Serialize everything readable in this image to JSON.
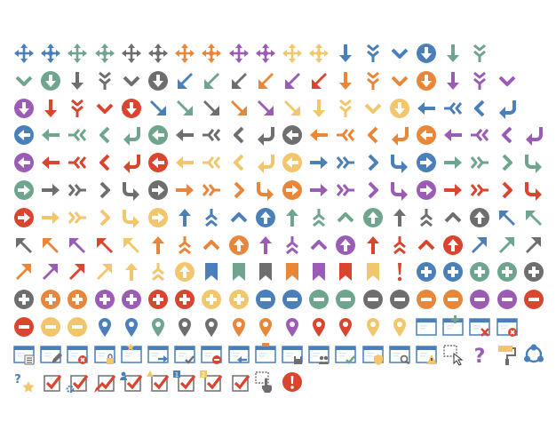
{
  "palette": {
    "blue": "#4A7FBA",
    "green": "#6FA58E",
    "orange": "#E8873A",
    "purple": "#9B5CB5",
    "yellow": "#F2C66D",
    "gray": "#6E6E6E",
    "red": "#D9452E"
  },
  "rows": [
    [
      [
        "move",
        "blue"
      ],
      [
        "move-dot",
        "blue"
      ],
      [
        "move",
        "green"
      ],
      [
        "move-dot",
        "green"
      ],
      [
        "move",
        "gray"
      ],
      [
        "move-dot",
        "gray"
      ],
      [
        "move",
        "orange"
      ],
      [
        "move-dot",
        "orange"
      ],
      [
        "move",
        "purple"
      ],
      [
        "move-dot",
        "purple"
      ],
      [
        "move",
        "yellow"
      ],
      [
        "move-dot",
        "yellow"
      ],
      [
        "down-arrow",
        "blue"
      ],
      [
        "down-chevrons",
        "blue"
      ],
      [
        "down-chevron",
        "blue"
      ],
      [
        "down-circle",
        "blue"
      ],
      [
        "down-arrow",
        "green"
      ],
      [
        "down-chevrons",
        "green"
      ]
    ],
    [
      [
        "down-chevron",
        "green"
      ],
      [
        "down-circle",
        "green"
      ],
      [
        "down-arrow",
        "gray"
      ],
      [
        "down-chevrons",
        "gray"
      ],
      [
        "down-chevron",
        "gray"
      ],
      [
        "down-circle",
        "gray"
      ],
      [
        "downleft-arrow",
        "blue"
      ],
      [
        "downleft-arrow",
        "green"
      ],
      [
        "downleft-arrow",
        "gray"
      ],
      [
        "downleft-arrow",
        "orange"
      ],
      [
        "downleft-arrow",
        "purple"
      ],
      [
        "downleft-arrow",
        "red"
      ],
      [
        "down-arrow",
        "orange"
      ],
      [
        "down-chevrons",
        "orange"
      ],
      [
        "down-chevron",
        "orange"
      ],
      [
        "down-circle",
        "orange"
      ],
      [
        "down-arrow",
        "purple"
      ],
      [
        "down-chevrons",
        "purple"
      ],
      [
        "down-chevron",
        "purple"
      ]
    ],
    [
      [
        "down-circle",
        "purple"
      ],
      [
        "down-arrow",
        "red"
      ],
      [
        "down-chevrons",
        "red"
      ],
      [
        "down-chevron",
        "red"
      ],
      [
        "down-circle",
        "red"
      ],
      [
        "downright-arrow",
        "blue"
      ],
      [
        "downright-arrow",
        "green"
      ],
      [
        "downright-arrow",
        "gray"
      ],
      [
        "downright-arrow",
        "orange"
      ],
      [
        "downright-arrow",
        "purple"
      ],
      [
        "downright-arrow",
        "yellow"
      ],
      [
        "down-arrow",
        "yellow"
      ],
      [
        "down-chevrons",
        "yellow"
      ],
      [
        "down-chevron",
        "yellow"
      ],
      [
        "down-circle",
        "yellow"
      ],
      [
        "left-arrow",
        "blue"
      ],
      [
        "left-chevrons",
        "blue"
      ],
      [
        "left-chevron",
        "blue"
      ],
      [
        "left-turn",
        "blue"
      ]
    ],
    [
      [
        "left-circle",
        "blue"
      ],
      [
        "left-arrow",
        "green"
      ],
      [
        "left-chevrons",
        "green"
      ],
      [
        "left-chevron",
        "green"
      ],
      [
        "left-turn",
        "green"
      ],
      [
        "left-circle",
        "green"
      ],
      [
        "left-arrow",
        "gray"
      ],
      [
        "left-chevrons",
        "gray"
      ],
      [
        "left-chevron",
        "gray"
      ],
      [
        "left-turn",
        "gray"
      ],
      [
        "left-circle",
        "gray"
      ],
      [
        "left-arrow",
        "orange"
      ],
      [
        "left-chevrons",
        "orange"
      ],
      [
        "left-chevron",
        "orange"
      ],
      [
        "left-turn",
        "orange"
      ],
      [
        "left-circle",
        "orange"
      ],
      [
        "left-arrow",
        "purple"
      ],
      [
        "left-chevrons",
        "purple"
      ],
      [
        "left-chevron",
        "purple"
      ],
      [
        "left-turn",
        "purple"
      ]
    ],
    [
      [
        "left-circle",
        "purple"
      ],
      [
        "left-arrow",
        "red"
      ],
      [
        "left-chevrons",
        "red"
      ],
      [
        "left-chevron",
        "red"
      ],
      [
        "left-turn",
        "red"
      ],
      [
        "left-circle",
        "red"
      ],
      [
        "left-arrow",
        "yellow"
      ],
      [
        "left-chevrons",
        "yellow"
      ],
      [
        "left-chevron",
        "yellow"
      ],
      [
        "left-turn",
        "yellow"
      ],
      [
        "left-circle",
        "yellow"
      ],
      [
        "right-arrow",
        "blue"
      ],
      [
        "right-chevrons",
        "blue"
      ],
      [
        "right-chevron",
        "blue"
      ],
      [
        "right-turn",
        "blue"
      ],
      [
        "right-circle",
        "blue"
      ],
      [
        "right-arrow",
        "green"
      ],
      [
        "right-chevrons",
        "green"
      ],
      [
        "right-chevron",
        "green"
      ],
      [
        "right-turn",
        "green"
      ]
    ],
    [
      [
        "right-circle",
        "green"
      ],
      [
        "right-arrow",
        "gray"
      ],
      [
        "right-chevrons",
        "gray"
      ],
      [
        "right-chevron",
        "gray"
      ],
      [
        "right-turn",
        "gray"
      ],
      [
        "right-circle",
        "gray"
      ],
      [
        "right-arrow",
        "orange"
      ],
      [
        "right-chevrons",
        "orange"
      ],
      [
        "right-chevron",
        "orange"
      ],
      [
        "right-turn",
        "orange"
      ],
      [
        "right-circle",
        "orange"
      ],
      [
        "right-arrow",
        "purple"
      ],
      [
        "right-chevrons",
        "purple"
      ],
      [
        "right-chevron",
        "purple"
      ],
      [
        "right-turn",
        "purple"
      ],
      [
        "right-circle",
        "purple"
      ],
      [
        "right-arrow",
        "red"
      ],
      [
        "right-chevrons",
        "red"
      ],
      [
        "right-chevron",
        "red"
      ],
      [
        "right-turn",
        "red"
      ]
    ],
    [
      [
        "right-circle",
        "red"
      ],
      [
        "right-arrow",
        "yellow"
      ],
      [
        "right-chevrons",
        "yellow"
      ],
      [
        "right-chevron",
        "yellow"
      ],
      [
        "right-turn",
        "yellow"
      ],
      [
        "right-circle",
        "yellow"
      ],
      [
        "up-arrow",
        "blue"
      ],
      [
        "up-chevrons",
        "blue"
      ],
      [
        "up-chevron",
        "blue"
      ],
      [
        "up-circle",
        "blue"
      ],
      [
        "up-arrow",
        "green"
      ],
      [
        "up-chevrons",
        "green"
      ],
      [
        "up-chevron",
        "green"
      ],
      [
        "up-circle",
        "green"
      ],
      [
        "up-arrow",
        "gray"
      ],
      [
        "up-chevrons",
        "gray"
      ],
      [
        "up-chevron",
        "gray"
      ],
      [
        "up-circle",
        "gray"
      ],
      [
        "upleft-arrow",
        "blue"
      ],
      [
        "upleft-arrow",
        "green"
      ]
    ],
    [
      [
        "upleft-arrow",
        "gray"
      ],
      [
        "upleft-arrow",
        "orange"
      ],
      [
        "upleft-arrow",
        "purple"
      ],
      [
        "upleft-arrow",
        "red"
      ],
      [
        "upleft-arrow",
        "yellow"
      ],
      [
        "up-arrow",
        "orange"
      ],
      [
        "up-chevrons",
        "orange"
      ],
      [
        "up-chevron",
        "orange"
      ],
      [
        "up-circle",
        "orange"
      ],
      [
        "up-arrow",
        "purple"
      ],
      [
        "up-chevrons",
        "purple"
      ],
      [
        "up-chevron",
        "purple"
      ],
      [
        "up-circle",
        "purple"
      ],
      [
        "up-arrow",
        "red"
      ],
      [
        "up-chevrons",
        "red"
      ],
      [
        "up-chevron",
        "red"
      ],
      [
        "up-circle",
        "red"
      ],
      [
        "upright-arrow",
        "blue"
      ],
      [
        "upright-arrow",
        "green"
      ],
      [
        "upright-arrow",
        "gray"
      ]
    ],
    [
      [
        "upright-arrow",
        "orange"
      ],
      [
        "upright-arrow",
        "purple"
      ],
      [
        "upright-arrow",
        "red"
      ],
      [
        "upright-arrow",
        "yellow"
      ],
      [
        "up-arrow",
        "yellow"
      ],
      [
        "up-chevrons",
        "yellow"
      ],
      [
        "up-circle",
        "yellow"
      ],
      [
        "bookmark",
        "blue"
      ],
      [
        "bookmark",
        "green"
      ],
      [
        "bookmark",
        "gray"
      ],
      [
        "bookmark",
        "orange"
      ],
      [
        "bookmark",
        "purple"
      ],
      [
        "bookmark",
        "red"
      ],
      [
        "bookmark",
        "yellow"
      ],
      [
        "exclamation",
        "red"
      ],
      [
        "plus-circle",
        "blue"
      ],
      [
        "plus-circle",
        "blue"
      ],
      [
        "plus-circle",
        "green"
      ],
      [
        "plus-circle",
        "green"
      ],
      [
        "plus-circle",
        "gray"
      ]
    ],
    [
      [
        "plus-circle",
        "gray"
      ],
      [
        "plus-circle",
        "orange"
      ],
      [
        "plus-circle",
        "orange"
      ],
      [
        "plus-circle",
        "purple"
      ],
      [
        "plus-circle",
        "purple"
      ],
      [
        "plus-circle",
        "red"
      ],
      [
        "plus-circle",
        "red"
      ],
      [
        "plus-circle",
        "yellow"
      ],
      [
        "plus-circle",
        "yellow"
      ],
      [
        "minus-circle",
        "blue"
      ],
      [
        "minus-circle",
        "blue"
      ],
      [
        "minus-circle",
        "green"
      ],
      [
        "minus-circle",
        "green"
      ],
      [
        "minus-circle",
        "gray"
      ],
      [
        "minus-circle",
        "gray"
      ],
      [
        "minus-circle",
        "orange"
      ],
      [
        "minus-circle",
        "orange"
      ],
      [
        "minus-circle",
        "purple"
      ],
      [
        "minus-circle",
        "purple"
      ],
      [
        "minus-circle",
        "red"
      ]
    ],
    [
      [
        "minus-circle",
        "red"
      ],
      [
        "minus-circle",
        "yellow"
      ],
      [
        "minus-circle",
        "yellow"
      ],
      [
        "map-pin",
        "blue"
      ],
      [
        "map-pin",
        "blue"
      ],
      [
        "map-pin",
        "green"
      ],
      [
        "map-pin",
        "gray"
      ],
      [
        "map-pin",
        "gray"
      ],
      [
        "map-pin",
        "orange"
      ],
      [
        "map-pin",
        "orange"
      ],
      [
        "map-pin",
        "purple"
      ],
      [
        "map-pin",
        "red"
      ],
      [
        "map-pin",
        "red"
      ],
      [
        "map-pin",
        "yellow"
      ],
      [
        "map-pin",
        "yellow"
      ],
      [
        "window-blank",
        "blue"
      ],
      [
        "window-add",
        "blue"
      ],
      [
        "window-close",
        "blue"
      ],
      [
        "window-remove",
        "blue"
      ]
    ],
    [
      [
        "window-list",
        "blue"
      ],
      [
        "window-edit",
        "blue"
      ],
      [
        "window-delete",
        "blue"
      ],
      [
        "window-lock",
        "blue"
      ],
      [
        "window-star",
        "blue"
      ],
      [
        "window-import",
        "blue"
      ],
      [
        "window-check",
        "blue"
      ],
      [
        "window-minus",
        "blue"
      ],
      [
        "window-back",
        "blue"
      ],
      [
        "window-up",
        "blue"
      ],
      [
        "window-save",
        "blue"
      ],
      [
        "window-group",
        "blue"
      ],
      [
        "window-accept",
        "blue"
      ],
      [
        "window-secure",
        "blue"
      ],
      [
        "window-search",
        "blue"
      ],
      [
        "window-warning",
        "blue"
      ],
      [
        "window-select",
        "gray"
      ],
      [
        "question-mark",
        "purple"
      ],
      [
        "paint-roller",
        "blue"
      ],
      [
        "share-circle",
        "blue"
      ]
    ],
    [
      [
        "help-star",
        "blue"
      ],
      [
        "checkbox",
        "red"
      ],
      [
        "checkbox-gear",
        "red"
      ],
      [
        "checkbox-pen",
        "red"
      ],
      [
        "checkbox-user",
        "red"
      ],
      [
        "checkbox-warn",
        "red"
      ],
      [
        "checkbox-num1",
        "red"
      ],
      [
        "checkbox-num2",
        "red"
      ],
      [
        "checkbox-plain",
        "red"
      ],
      [
        "select-touch",
        "gray"
      ],
      [
        "alert-circle",
        "red"
      ]
    ]
  ]
}
